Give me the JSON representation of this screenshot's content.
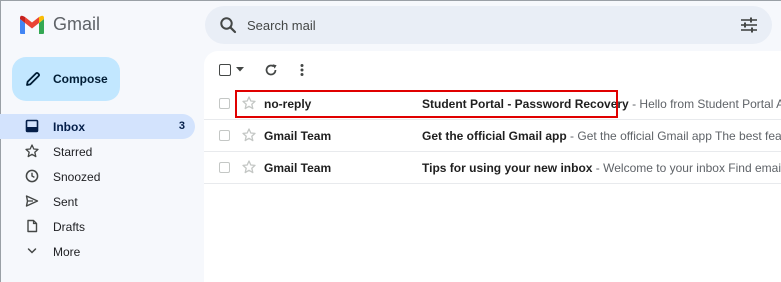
{
  "app": {
    "name": "Gmail"
  },
  "search": {
    "placeholder": "Search mail"
  },
  "compose": {
    "label": "Compose"
  },
  "sidebar": {
    "items": [
      {
        "label": "Inbox",
        "count": "3",
        "icon": "inbox-icon",
        "active": true
      },
      {
        "label": "Starred",
        "icon": "star-icon"
      },
      {
        "label": "Snoozed",
        "icon": "clock-icon"
      },
      {
        "label": "Sent",
        "icon": "send-icon"
      },
      {
        "label": "Drafts",
        "icon": "draft-icon"
      },
      {
        "label": "More",
        "icon": "chevron-down-icon"
      }
    ]
  },
  "emails": [
    {
      "sender": "no-reply",
      "subject": "Student Portal - Password Recovery",
      "snippet": "Hello from Student Portal A req"
    },
    {
      "sender": "Gmail Team",
      "subject": "Get the official Gmail app",
      "snippet": "Get the official Gmail app The best feature"
    },
    {
      "sender": "Gmail Team",
      "subject": "Tips for using your new inbox",
      "snippet": "Welcome to your inbox Find emails fast"
    }
  ],
  "colors": {
    "accent_highlight": "#e00000",
    "compose_bg": "#c2e7ff",
    "active_nav_bg": "#d3e3fd",
    "page_bg": "#f6f8fc"
  }
}
